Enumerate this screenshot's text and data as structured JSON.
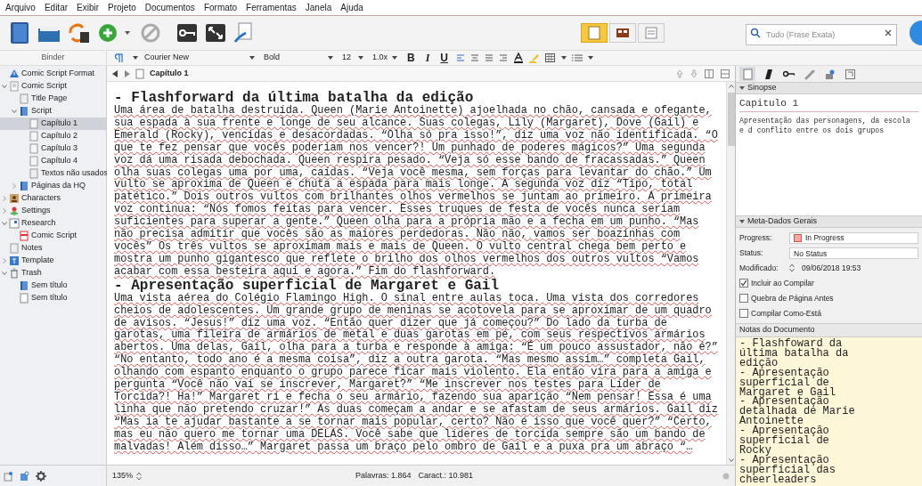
{
  "menu": [
    "Arquivo",
    "Editar",
    "Exibir",
    "Projeto",
    "Documentos",
    "Formato",
    "Ferramentas",
    "Janela",
    "Ajuda"
  ],
  "toolbar": {
    "search": {
      "placeholder": "Tudo (Frase Exata)"
    },
    "view_modes": [
      {
        "selected": true
      },
      {
        "selected": false
      },
      {
        "selected": false
      }
    ]
  },
  "format_bar": {
    "font": "Courier New",
    "weight": "Bold",
    "size": "12",
    "spacing": "1.0x",
    "buttons": [
      "B",
      "I",
      "U"
    ]
  },
  "binder": {
    "header": "Binder",
    "items": [
      {
        "label": "Comic Script Format",
        "kind": "warning",
        "selected": false
      },
      {
        "label": "Comic Script",
        "kind": "doc",
        "selected": false,
        "expanded": true,
        "children": [
          {
            "label": "Title Page",
            "kind": "page",
            "selected": false
          },
          {
            "label": "Script",
            "kind": "folder",
            "selected": false,
            "expanded": true,
            "children": [
              {
                "label": "Capítulo 1",
                "kind": "chapter",
                "selected": true
              },
              {
                "label": "Capítulo 2",
                "kind": "chapter",
                "selected": false
              },
              {
                "label": "Capítulo 3",
                "kind": "chapter",
                "selected": false
              },
              {
                "label": "Capítulo 4",
                "kind": "chapter",
                "selected": false
              },
              {
                "label": "Textos não usados",
                "kind": "page",
                "selected": false
              }
            ]
          },
          {
            "label": "Páginas da HQ",
            "kind": "folder",
            "selected": false,
            "expanded": false
          }
        ]
      },
      {
        "label": "Characters",
        "kind": "person",
        "selected": false,
        "expanded": false
      },
      {
        "label": "Settings",
        "kind": "place",
        "selected": false,
        "expanded": false
      },
      {
        "label": "Research",
        "kind": "research",
        "selected": false,
        "expanded": true,
        "children": [
          {
            "label": "Comic Script",
            "kind": "pdf",
            "selected": false
          }
        ]
      },
      {
        "label": "Notes",
        "kind": "page",
        "selected": false
      },
      {
        "label": "Template",
        "kind": "template",
        "selected": false,
        "expanded": false
      },
      {
        "label": "Trash",
        "kind": "trash",
        "selected": false,
        "expanded": true,
        "children": [
          {
            "label": "Sem título",
            "kind": "folder",
            "selected": false
          },
          {
            "label": "Sem título",
            "kind": "blank",
            "selected": false
          }
        ]
      }
    ]
  },
  "editor": {
    "title": "Capítulo 1",
    "sections": [
      {
        "heading": "- Flashforward da última batalha da edição",
        "lines": [
          "Uma área de batalha destruída. Queen (Marie Antoinette) ajoelhada no chão, cansada e ofegante,",
          "sua espada à sua frente e longe de seu alcance. Suas colegas, Lily (Margaret), Dove (Gail) e",
          "Emerald (Rocky), vencidas e desacordadas. “Olha só pra isso!”, diz uma voz não identificada. “O",
          "que te fez pensar que vocês poderiam nos vencer?! Um punhado de poderes mágicos?” Uma segunda",
          "voz dá uma risada debochada. Queen respira pesado. “Veja só esse bando de fracassadas.” Queen",
          "olha suas colegas uma por uma, caídas. “Veja você mesma, sem forças para levantar do chão.” Um",
          "vulto se aproxima de Queen e chuta a espada para mais longe. A segunda voz diz “Tipo, total",
          "patético.” Dois outros vultos com brilhantes olhos vermelhos se juntam ao primeiro. A primeira",
          "voz continua: “Nós fomos feitas para vencer. Esses truques de festa de vocês nunca seriam",
          "suficientes para superar a gente.” Queen olha para a própria mão e a fecha em um punho. “Mas",
          "não precisa admitir que vocês são as maiores perdedoras. Não não, vamos ser boazinhas com",
          "vocês” Os três vultos se aproximam mais e mais de Queen. O vulto central chega bem perto e",
          "mostra um punho gigantesco que reflete o brilho dos olhos vermelhos dos outros vultos “Vamos",
          "acabar com essa besteira aqui e agora.” Fim do flashforward."
        ]
      },
      {
        "heading": "- Apresentação superficial de Margaret e Gail",
        "lines": [
          "Uma vista aérea do Colégio Flamingo High. O sinal entre aulas toca. Uma vista dos corredores",
          "cheios de adolescentes. Um grande grupo de meninas se acotovela para se aproximar de um quadro",
          "de avisos. “Jesus!” diz uma voz. “Então quer dizer que já começou?” Do lado da turba de",
          "garotas, uma fileira de armários de metal e duas garotas em pé, com seus respectivos armários",
          "abertos. Uma delas, Gail, olha para a turba e responde à amiga: “É um pouco assustador, não é?”",
          "“No entanto, todo ano é a mesma coisa”, diz a outra garota. “Mas mesmo assim…” completa Gail,",
          "olhando com espanto enquanto o grupo parece ficar mais violento. Ela então vira para a amiga e",
          "pergunta “Você não vai se inscrever, Margaret?” “Me inscrever nos testes para Líder de",
          "Torcida?! Ha!” Margaret ri e fecha o seu armário, fazendo sua aparição “Nem pensar! Essa é uma",
          "linha que não pretendo cruzar!” As duas começam a andar e se afastam de seus armários. Gail diz",
          "“Mas ia te ajudar bastante a se tornar mais popular, certo? Não é isso que você quer?” “Certo,",
          "mas eu não quero me tornar uma DELAS. Você sabe que líderes de torcida sempre são um bando de",
          "malvadas! Além disso…” Margaret passa um braço pelo ombro de Gail e a puxa pra um abraço “…"
        ]
      }
    ]
  },
  "status_bar": {
    "zoom": "135%",
    "words": "Palavras: 1.864",
    "chars": "Caract.: 10.981"
  },
  "inspector": {
    "synopsis": {
      "header": "Sinopse",
      "title": "Capitulo 1",
      "text": "Apresentação das personagens, da escola e d conflito entre os dois grupos"
    },
    "metadata": {
      "header": "Meta-Dados Gerais",
      "progress": {
        "label": "Progress:",
        "value": "In Progress",
        "color": "#f4a9a0"
      },
      "status": {
        "label": "Status:",
        "value": "No Status"
      },
      "modified": {
        "label": "Modificado:",
        "value": "09/06/2018 19:53"
      },
      "options": [
        {
          "label": "Incluir ao Compilar",
          "checked": true
        },
        {
          "label": "Quebra de Página Antes",
          "checked": false
        },
        {
          "label": "Compilar Como-Está",
          "checked": false
        }
      ]
    },
    "notes": {
      "header": "Notas do Documento",
      "items": [
        "- Flashfoward da última batalha da edição",
        "- Apresentação superficial de Margaret e Gail",
        "- Apresentação detalhada de Marie Antoinette",
        "- Apresentação superficial de Rocky",
        "- Apresentação superficial das cheerleaders"
      ]
    }
  }
}
